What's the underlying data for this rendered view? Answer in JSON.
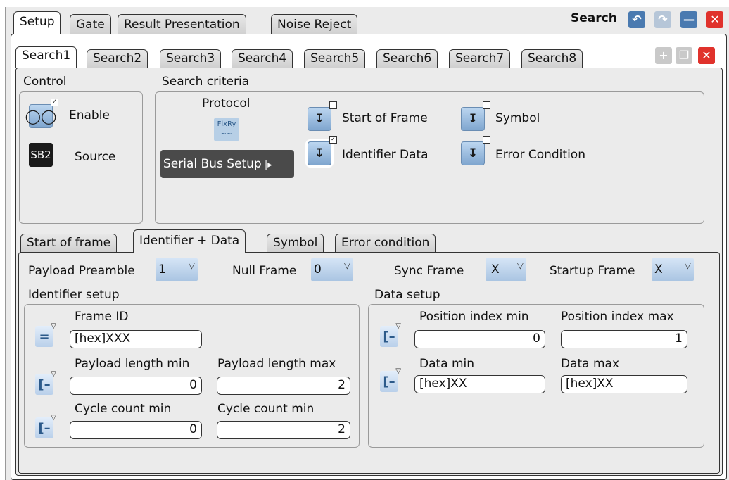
{
  "window": {
    "title": "Search",
    "colors": {
      "accent": "#4a7ab0",
      "close": "#e0322c",
      "panel_bg": "#ebebeb"
    },
    "controls": [
      "undo-icon",
      "redo-icon",
      "minimize-icon",
      "close-icon"
    ]
  },
  "top_tabs": [
    "Setup",
    "Gate",
    "Result Presentation",
    "Noise Reject"
  ],
  "search_tabs": [
    "Search1",
    "Search2",
    "Search3",
    "Search4",
    "Search5",
    "Search6",
    "Search7",
    "Search8"
  ],
  "search_tab_controls": [
    "add-icon",
    "copy-icon",
    "delete-icon"
  ],
  "control": {
    "title": "Control",
    "enable_label": "Enable",
    "source_label": "Source",
    "source_icon_text": "SB2"
  },
  "criteria": {
    "title": "Search criteria",
    "protocol_label": "Protocol",
    "protocol_icon_text": "FlxRy",
    "serial_bus_button": "Serial Bus Setup",
    "items": [
      {
        "label": "Start of Frame",
        "checked": false
      },
      {
        "label": "Symbol",
        "checked": false
      },
      {
        "label": "Identifier Data",
        "checked": true
      },
      {
        "label": "Error Condition",
        "checked": false
      }
    ]
  },
  "criteria_tabs": [
    "Start of frame",
    "Identifier + Data",
    "Symbol",
    "Error condition"
  ],
  "frame_options": [
    {
      "label": "Payload Preamble",
      "value": "1"
    },
    {
      "label": "Null Frame",
      "value": "0"
    },
    {
      "label": "Sync Frame",
      "value": "X"
    },
    {
      "label": "Startup Frame",
      "value": "X"
    }
  ],
  "identifier_setup": {
    "title": "Identifier setup",
    "frame_id_label": "Frame ID",
    "frame_id_value": "[hex]XXX",
    "payload_min_label": "Payload length min",
    "payload_min_value": "0",
    "payload_max_label": "Payload length max",
    "payload_max_value": "2",
    "cycle_min_label": "Cycle count min",
    "cycle_min_value": "0",
    "cycle_max_label": "Cycle count min",
    "cycle_max_value": "2"
  },
  "data_setup": {
    "title": "Data setup",
    "pos_min_label": "Position index min",
    "pos_min_value": "0",
    "pos_max_label": "Position index max",
    "pos_max_value": "1",
    "data_min_label": "Data min",
    "data_min_value": "[hex]XX",
    "data_max_label": "Data max",
    "data_max_value": "[hex]XX"
  }
}
